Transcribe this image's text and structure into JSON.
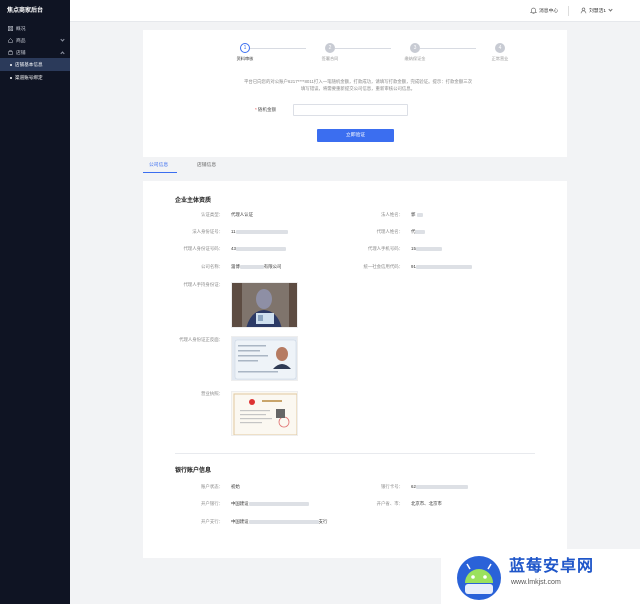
{
  "app": {
    "title": "焦点商家后台"
  },
  "sidebar": {
    "items": [
      {
        "label": "概况",
        "icon": "grid-icon"
      },
      {
        "label": "商品",
        "icon": "home-icon"
      },
      {
        "label": "店铺",
        "icon": "shop-icon"
      }
    ],
    "sub_items": [
      {
        "label": "店铺基本信息",
        "active": true
      },
      {
        "label": "渠道账号绑定",
        "active": false
      }
    ]
  },
  "header": {
    "message_center": "消息中心",
    "user_name": "刘慧洁1"
  },
  "steps": [
    {
      "num": "1",
      "label": "资料审核",
      "active": true
    },
    {
      "num": "2",
      "label": "签署合同",
      "active": false
    },
    {
      "num": "3",
      "label": "缴纳保证金",
      "active": false
    },
    {
      "num": "4",
      "label": "正常营业",
      "active": false
    }
  ],
  "verify": {
    "notice_line1": "平台已向您的对公账户6217****8011打入一笔随机金额，打款成功，请填写打款金额，完成验证。提示：打款金额三次",
    "notice_line2": "填写错误，将需要重新提交公司信息，重新审核公司信息。",
    "amount_label": "随机金额",
    "amount_required": "*",
    "amount_value": "",
    "button": "立即验证"
  },
  "tabs": [
    {
      "label": "公司信息",
      "active": true
    },
    {
      "label": "店铺信息",
      "active": false
    }
  ],
  "company": {
    "title": "企业主体资质",
    "fields": {
      "auth_type_label": "认证类型：",
      "auth_type_value": "代理人认证",
      "legal_name_label": "法人姓名：",
      "legal_name_value": "郭",
      "legal_id_label": "法人身份证号：",
      "legal_id_value": "11",
      "agent_name_label": "代理人姓名：",
      "agent_name_value": "代",
      "agent_id_label": "代理人身份证号码：",
      "agent_id_value": "43",
      "agent_phone_label": "代理人手机号码：",
      "agent_phone_value": "15",
      "company_name_label": "公司名称：",
      "company_name_value": "淄博",
      "company_name_suffix": "有限公司",
      "credit_code_label": "统一社会信用代码：",
      "credit_code_value": "91",
      "agent_photo_label": "代理人手持身份证：",
      "agent_id_front_label": "代理人身份证正反面：",
      "license_label": "营业执照："
    }
  },
  "bank": {
    "title": "银行账户信息",
    "status_label": "账户状态：",
    "status_value": "初始",
    "card_label": "银行卡号：",
    "card_value": "62",
    "bank_label": "开户银行：",
    "bank_value": "中国建设",
    "region_label": "开户省、市：",
    "region_value": "北京市、北京市",
    "branch_label": "开户支行：",
    "branch_value": "中国建设",
    "branch_suffix": "支行"
  },
  "watermark": {
    "title": "蓝莓安卓网",
    "url": "www.lmkjst.com"
  },
  "colors": {
    "accent": "#3b6ef0",
    "sidebar_bg": "#0f1423",
    "active_sub": "#2b3a5a"
  }
}
